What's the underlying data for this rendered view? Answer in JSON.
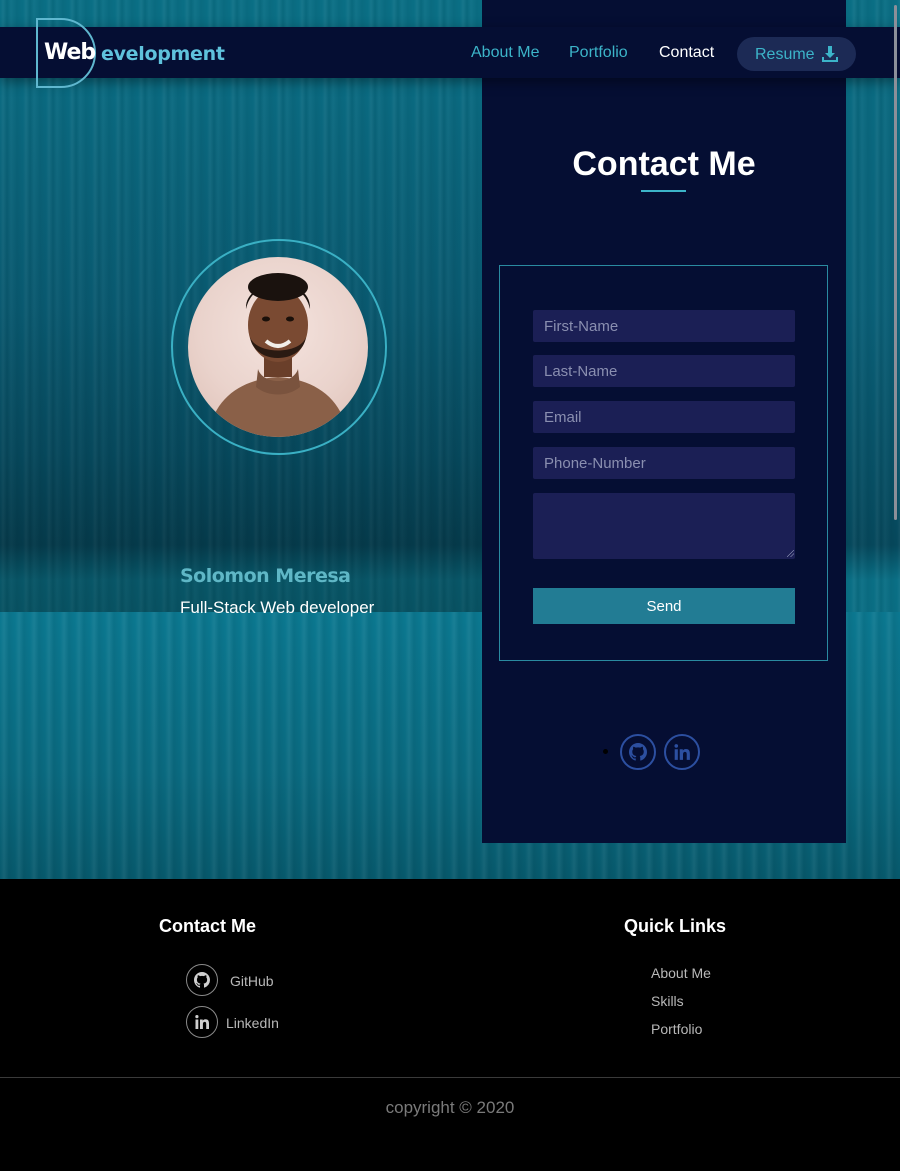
{
  "brand": {
    "logo_prefix": "Web",
    "logo_suffix": "evelopment"
  },
  "nav": {
    "items": [
      {
        "label": "About Me"
      },
      {
        "label": "Portfolio"
      },
      {
        "label": "Contact"
      }
    ],
    "resume_label": "Resume"
  },
  "profile": {
    "name": "Solomon Meresa",
    "role": "Full-Stack Web developer"
  },
  "contact_form": {
    "title": "Contact Me",
    "first_name_placeholder": "First-Name",
    "last_name_placeholder": "Last-Name",
    "email_placeholder": "Email",
    "phone_placeholder": "Phone-Number",
    "message_value": "",
    "send_label": "Send"
  },
  "footer": {
    "contact_heading": "Contact Me",
    "social": [
      {
        "label": "GitHub",
        "icon": "github-icon"
      },
      {
        "label": "LinkedIn",
        "icon": "linkedin-icon"
      }
    ],
    "quick_links_heading": "Quick Links",
    "quick_links": [
      {
        "label": "About Me"
      },
      {
        "label": "Skills"
      },
      {
        "label": "Portfolio"
      }
    ],
    "copyright": "copyright © 2020"
  },
  "colors": {
    "accent": "#3cb4c9",
    "panel": "#050e33",
    "input_bg": "#1b1f55",
    "button": "#227c94"
  }
}
